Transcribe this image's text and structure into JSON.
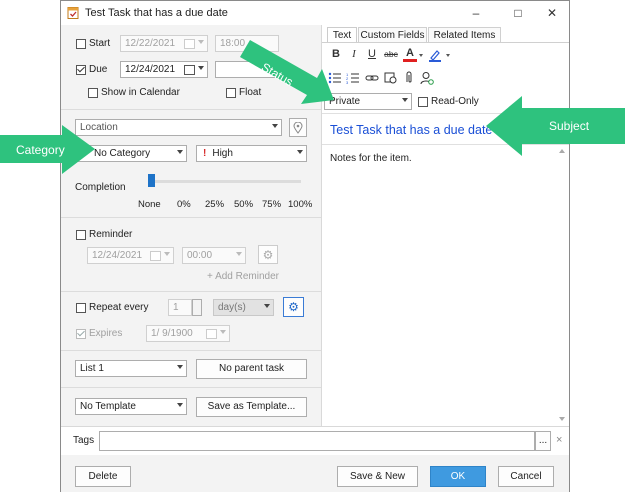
{
  "window": {
    "title": "Test Task that has a due date",
    "minimize": "–",
    "maximize": "□",
    "close": "✕"
  },
  "left": {
    "start_label": "Start",
    "start_date": "12/22/2021",
    "start_time": "18:00",
    "due_label": "Due",
    "due_date": "12/24/2021",
    "due_time": "",
    "show_in_calendar": "Show in Calendar",
    "float": "Float",
    "location_placeholder": "Location",
    "category_value": "No Category",
    "priority_mark": "!",
    "priority_value": "High",
    "completion_label": "Completion",
    "completion_ticks": [
      "None",
      "0%",
      "25%",
      "50%",
      "75%",
      "100%"
    ],
    "completion_value": 0,
    "reminder_label": "Reminder",
    "reminder_date": "12/24/2021",
    "reminder_time": "00:00",
    "add_reminder": "+ Add Reminder",
    "repeat_label": "Repeat every",
    "repeat_count": "1",
    "repeat_unit": "day(s)",
    "expires_label": "Expires",
    "expires_date": "1/  9/1900",
    "list_value": "List 1",
    "parent_task": "No parent task",
    "template_value": "No Template",
    "save_template": "Save as Template..."
  },
  "right": {
    "tabs": [
      "Text",
      "Custom Fields",
      "Related Items"
    ],
    "privacy_value": "Private",
    "readonly_label": "Read-Only",
    "subject": "Test Task that has a due date",
    "notes": "Notes for the item."
  },
  "bottom": {
    "tags_label": "Tags",
    "tags_value": "",
    "tags_more": "...",
    "tags_clear": "×",
    "delete": "Delete",
    "save_new": "Save & New",
    "ok": "OK",
    "cancel": "Cancel"
  },
  "annotations": {
    "status": "Status",
    "category": "Category",
    "subject": "Subject"
  },
  "colors": {
    "annotation": "#2ec27e",
    "subject_text": "#1a4fd6",
    "primary_button": "#3f9ae0",
    "slider_thumb": "#1e73c8",
    "priority_mark": "#d62b2b"
  }
}
